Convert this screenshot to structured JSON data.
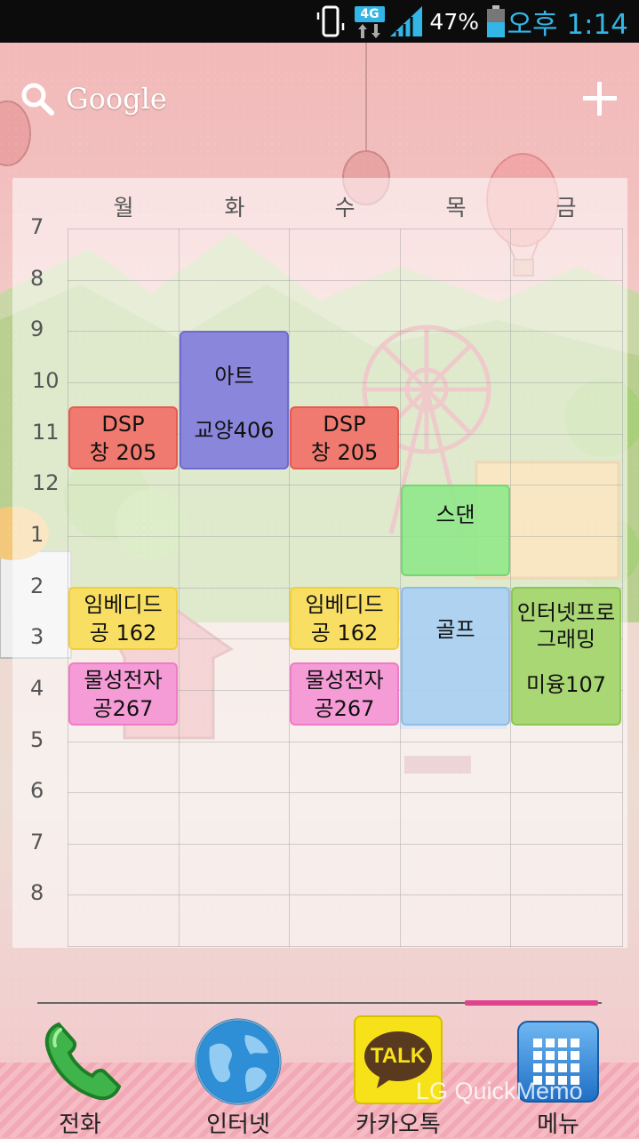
{
  "status_bar": {
    "network": "4G",
    "battery": "47%",
    "time": "오후 1:14"
  },
  "search": {
    "label": "Google"
  },
  "timetable": {
    "days": [
      "월",
      "화",
      "수",
      "목",
      "금"
    ],
    "hours": [
      "7",
      "8",
      "9",
      "10",
      "11",
      "12",
      "1",
      "2",
      "3",
      "4",
      "5",
      "6",
      "7",
      "8"
    ],
    "events": [
      {
        "day": "월",
        "name": "DSP",
        "room": "창 205",
        "color": "#f07a6f"
      },
      {
        "day": "화",
        "name": "아트",
        "room": "교양406",
        "color": "#8a86dc"
      },
      {
        "day": "수",
        "name": "DSP",
        "room": "창 205",
        "color": "#f07a6f"
      },
      {
        "day": "목",
        "name": "스댄",
        "room": "",
        "color": "#8fe88a"
      },
      {
        "day": "월",
        "name": "임베디드",
        "room": "공 162",
        "color": "#f8df63"
      },
      {
        "day": "수",
        "name": "임베디드",
        "room": "공 162",
        "color": "#f8df63"
      },
      {
        "day": "목",
        "name": "골프",
        "room": "",
        "color": "#a9cff0"
      },
      {
        "day": "금",
        "name": "인터넷프로그래밍",
        "room": "미융107",
        "color": "#a8d774"
      },
      {
        "day": "월",
        "name": "물성전자",
        "room": "공267",
        "color": "#f59bd6"
      },
      {
        "day": "수",
        "name": "물성전자",
        "room": "공267",
        "color": "#f59bd6"
      }
    ]
  },
  "dock": {
    "items": [
      {
        "label": "전화",
        "icon": "phone-icon"
      },
      {
        "label": "인터넷",
        "icon": "globe-icon"
      },
      {
        "label": "카카오톡",
        "icon": "kakaotalk-icon",
        "icon_text": "TALK"
      },
      {
        "label": "메뉴",
        "icon": "app-menu-icon"
      }
    ]
  },
  "watermark": "LG QuickMemo"
}
